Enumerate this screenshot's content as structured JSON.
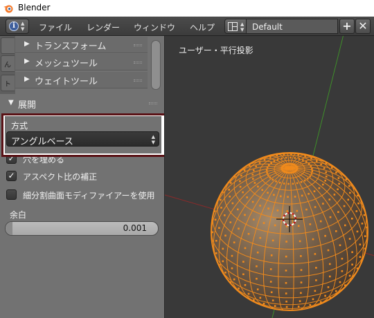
{
  "window": {
    "title": "Blender"
  },
  "infobar": {
    "menus": [
      "ファイル",
      "レンダー",
      "ウィンドウ",
      "ヘルプ"
    ],
    "screen_layout": "Default",
    "add_glyph": "+",
    "close_glyph": "✕"
  },
  "shelf": {
    "panels": [
      "トランスフォーム",
      "メッシュツール",
      "ウェイトツール"
    ],
    "unwrap_section": "展開",
    "method_label": "方式",
    "method_value": "アングルベース",
    "fill_holes_label": "穴を埋める",
    "fill_holes_checked": true,
    "aspect_label": "アスペクト比の補正",
    "aspect_checked": true,
    "subsurf_label": "細分割曲面モディファイアーを使用",
    "subsurf_checked": false,
    "margin_label": "余白",
    "margin_value": "0.001"
  },
  "viewport": {
    "view_label": "ユーザー・平行投影"
  },
  "colors": {
    "selection_orange": "#f08a1c",
    "highlight_border": "#5a1216",
    "viewport_bg": "#393939",
    "panel_bg": "#727272"
  },
  "icons": [
    "blender-logo-icon",
    "info-icon",
    "layout-grid-icon",
    "add-icon",
    "close-icon",
    "cursor-3d-icon"
  ]
}
